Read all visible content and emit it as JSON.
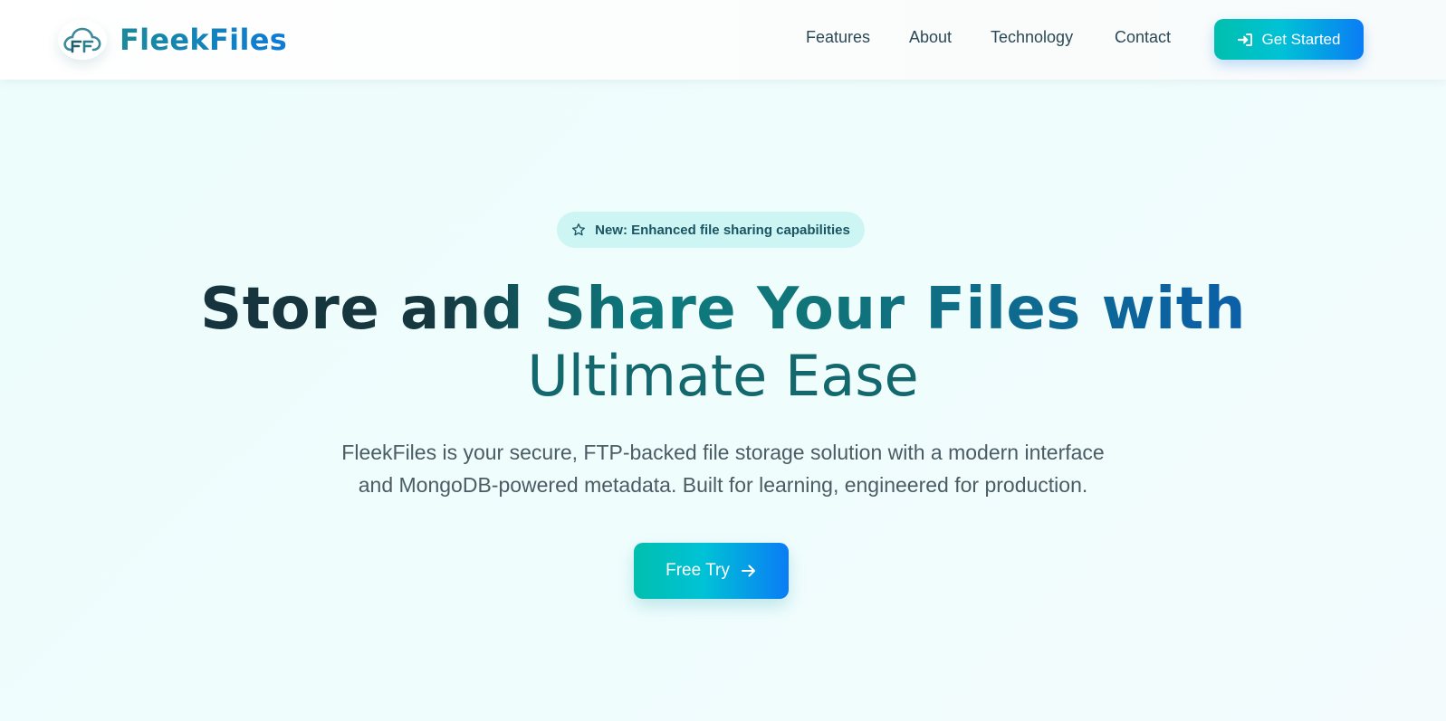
{
  "brand": {
    "name": "FleekFiles",
    "logo_icon": "cloud-ff-logo-icon"
  },
  "nav": {
    "items": [
      {
        "label": "Features"
      },
      {
        "label": "About"
      },
      {
        "label": "Technology"
      },
      {
        "label": "Contact"
      }
    ],
    "cta_label": "Get Started",
    "cta_icon": "sign-in-icon"
  },
  "hero": {
    "badge": {
      "icon": "star-icon",
      "text": "New: Enhanced file sharing capabilities"
    },
    "title_line1": "Store and Share Your Files with",
    "title_line2": "Ultimate Ease",
    "subtitle_line1": "FleekFiles is your secure, FTP-backed file storage solution with a modern interface",
    "subtitle_line2": "and MongoDB-powered metadata. Built for learning, engineered for production.",
    "cta_label": "Free Try",
    "cta_icon": "arrow-right-icon"
  },
  "colors": {
    "accent_start": "#00bfae",
    "accent_end": "#0a7cf5",
    "brand_text": "#1a8a9a",
    "badge_bg": "#ccf5f4",
    "background": "#ecfdfc"
  }
}
